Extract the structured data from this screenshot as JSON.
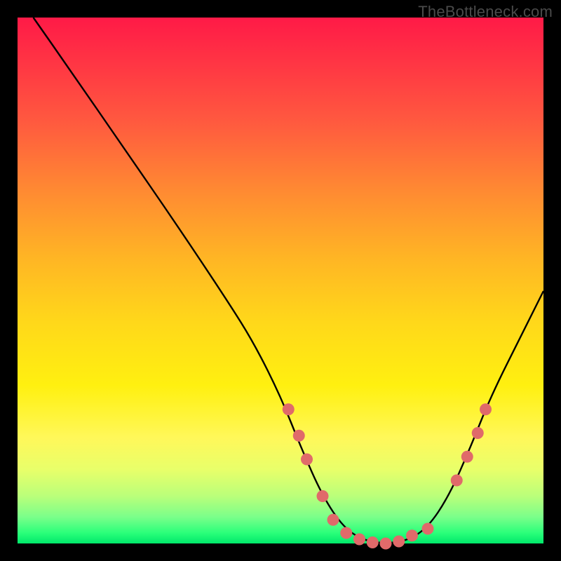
{
  "watermark": "TheBottleneck.com",
  "chart_data": {
    "type": "line",
    "title": "",
    "xlabel": "",
    "ylabel": "",
    "xlim": [
      0,
      100
    ],
    "ylim": [
      0,
      100
    ],
    "series": [
      {
        "name": "curve",
        "x": [
          3,
          10,
          20,
          30,
          40,
          45,
          50,
          54,
          58,
          62,
          66,
          70,
          74,
          78,
          82,
          86,
          90,
          96,
          100
        ],
        "y": [
          100,
          90,
          75.5,
          61,
          46,
          38,
          28,
          18,
          9,
          3,
          0.5,
          0,
          0.5,
          3,
          9,
          18,
          28,
          40,
          48
        ]
      }
    ],
    "markers": {
      "name": "dots",
      "color": "#e06a6a",
      "points": [
        {
          "x": 51.5,
          "y": 25.5
        },
        {
          "x": 53.5,
          "y": 20.5
        },
        {
          "x": 55.0,
          "y": 16.0
        },
        {
          "x": 58.0,
          "y": 9.0
        },
        {
          "x": 60.0,
          "y": 4.5
        },
        {
          "x": 62.5,
          "y": 2.0
        },
        {
          "x": 65.0,
          "y": 0.8
        },
        {
          "x": 67.5,
          "y": 0.2
        },
        {
          "x": 70.0,
          "y": 0.0
        },
        {
          "x": 72.5,
          "y": 0.4
        },
        {
          "x": 75.0,
          "y": 1.5
        },
        {
          "x": 78.0,
          "y": 2.8
        },
        {
          "x": 83.5,
          "y": 12.0
        },
        {
          "x": 85.5,
          "y": 16.5
        },
        {
          "x": 87.5,
          "y": 21.0
        },
        {
          "x": 89.0,
          "y": 25.5
        }
      ]
    }
  }
}
